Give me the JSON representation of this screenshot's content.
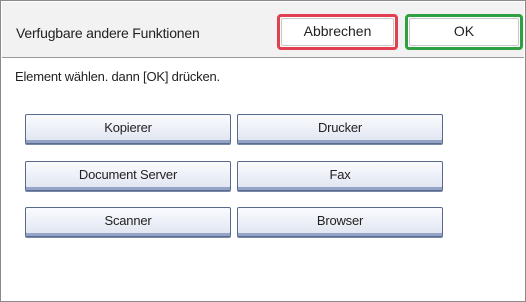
{
  "header": {
    "title": "Verfugbare andere Funktionen",
    "cancel_label": "Abbrechen",
    "ok_label": "OK"
  },
  "instruction": "Element wählen. dann [OK] drücken.",
  "functions": [
    {
      "label": "Kopierer"
    },
    {
      "label": "Drucker"
    },
    {
      "label": "Document Server"
    },
    {
      "label": "Fax"
    },
    {
      "label": "Scanner"
    },
    {
      "label": "Browser"
    }
  ],
  "colors": {
    "cancel_border": "#e04050",
    "ok_border": "#2fa040",
    "button_shadow": "#93a4c8"
  }
}
